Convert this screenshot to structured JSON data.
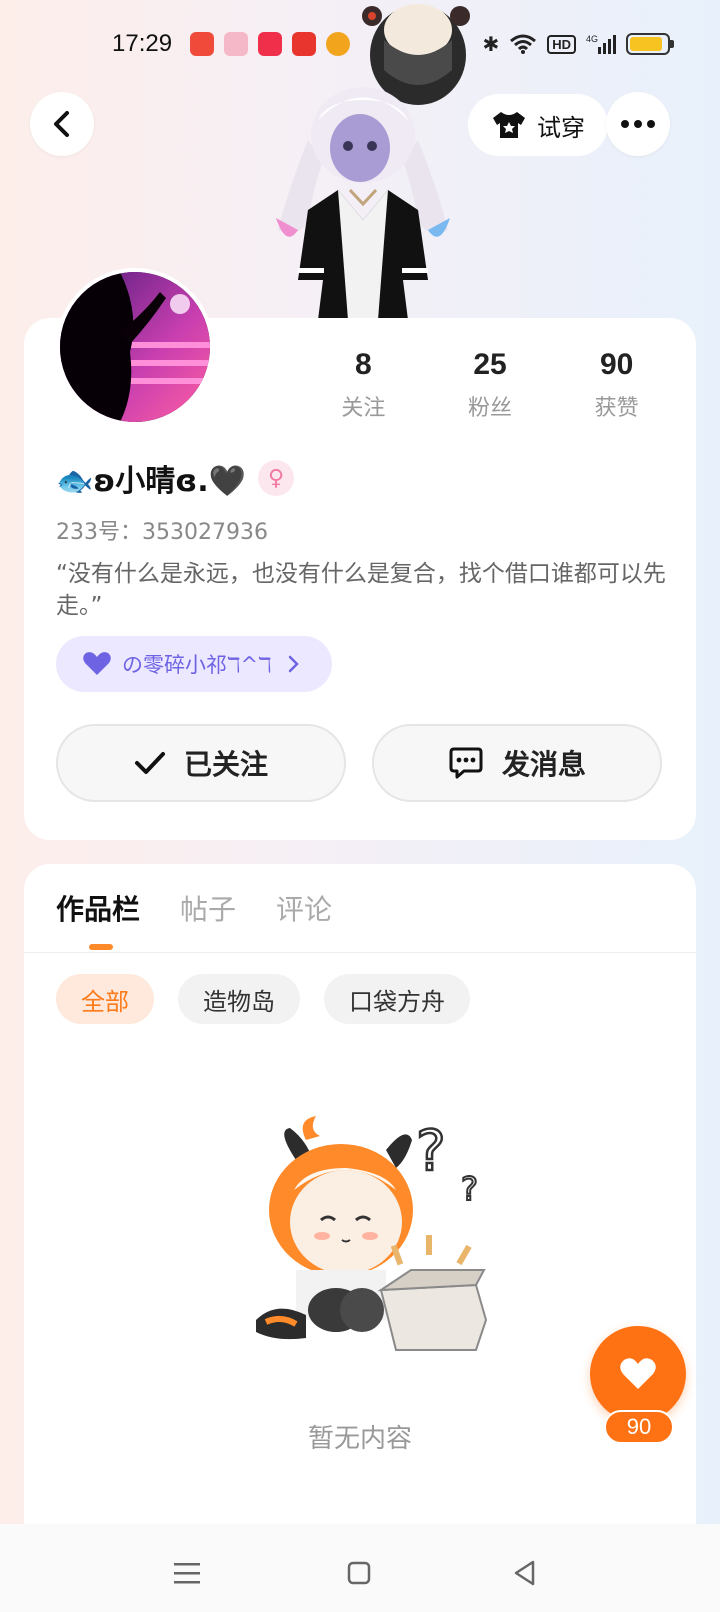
{
  "status_bar": {
    "time": "17:29",
    "network": "4G",
    "hd": "HD",
    "app_icons": [
      {
        "name": "music-app-icon",
        "color": "#f04b3a"
      },
      {
        "name": "heart-app-icon",
        "color": "#f5b8c8"
      },
      {
        "name": "video-app-icon",
        "color": "#f0304a"
      },
      {
        "name": "news-app-icon",
        "color": "#e8352e"
      },
      {
        "name": "weibo-app-icon",
        "color": "#f2a51c"
      }
    ]
  },
  "header": {
    "try_on_label": "试穿"
  },
  "profile": {
    "stats": [
      {
        "value": "8",
        "label": "关注"
      },
      {
        "value": "25",
        "label": "粉丝"
      },
      {
        "value": "90",
        "label": "获赞"
      }
    ],
    "nickname": "🐟ʚ小晴ɞ.🖤",
    "uid": "233号：353027936",
    "bio": "“没有什么是永远，也没有什么是复合，找个借口谁都可以先走。”",
    "guild_name": "の零碎小祁ℸ^ℸ",
    "followed_label": "已关注",
    "message_label": "发消息"
  },
  "works": {
    "tabs": [
      {
        "label": "作品栏",
        "active": true
      },
      {
        "label": "帖子",
        "active": false
      },
      {
        "label": "评论",
        "active": false
      }
    ],
    "filters": [
      {
        "label": "全部",
        "active": true
      },
      {
        "label": "造物岛",
        "active": false
      },
      {
        "label": "口袋方舟",
        "active": false
      }
    ],
    "empty_text": "暂无内容"
  },
  "like_fab": {
    "count": "90"
  },
  "colors": {
    "accent": "#ff7214",
    "guild": "#6e63e3"
  }
}
